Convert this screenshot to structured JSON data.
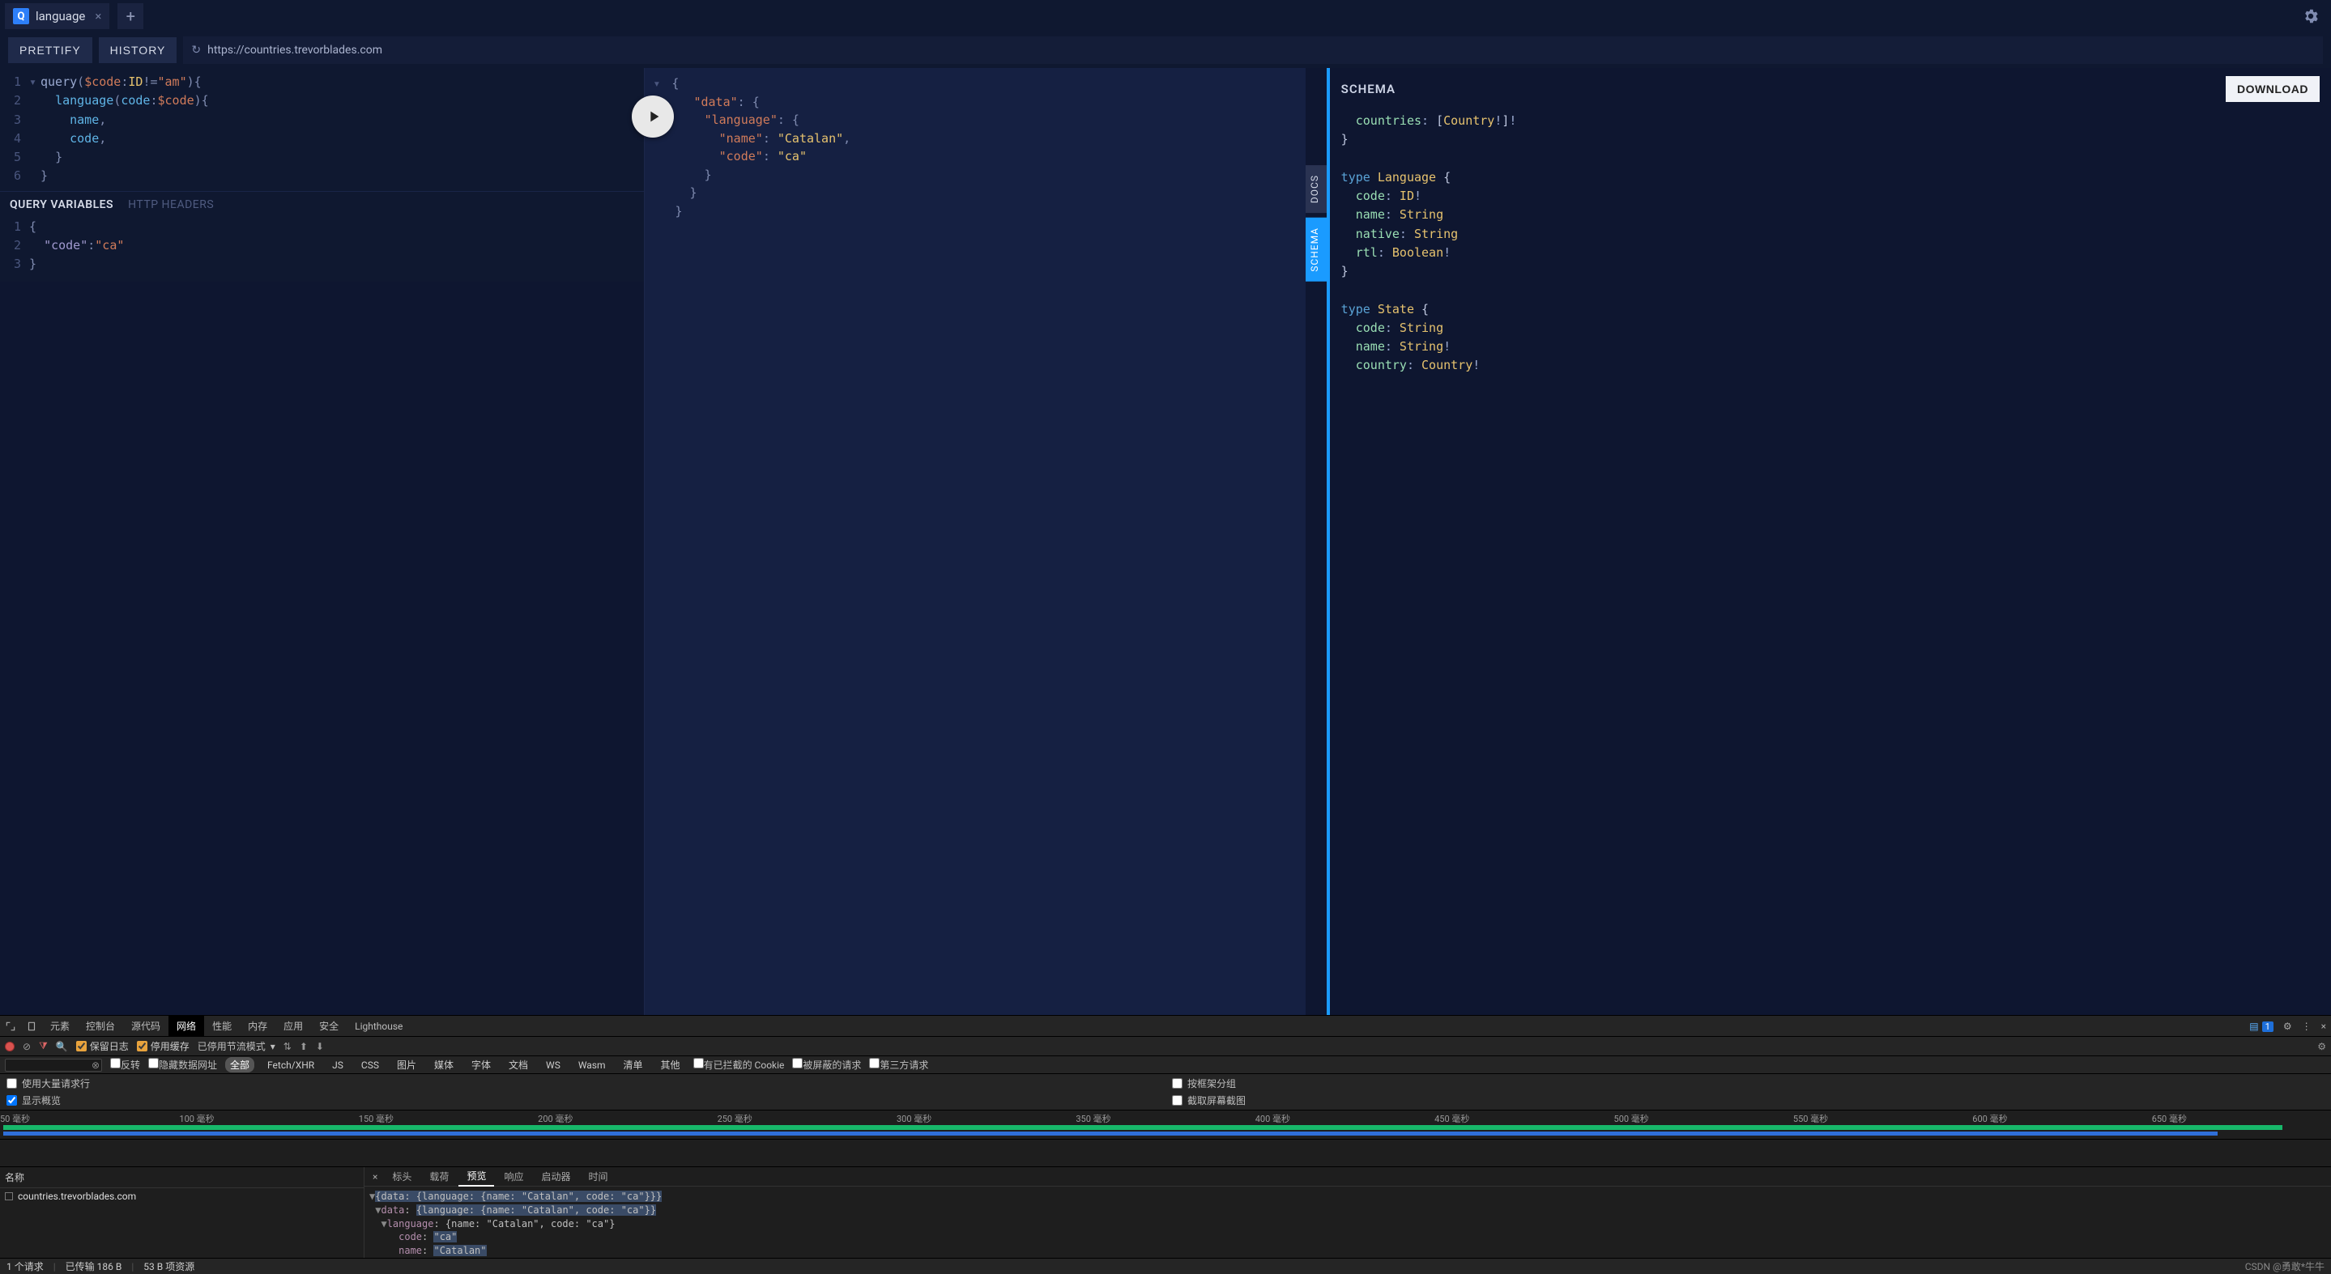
{
  "tabs": {
    "active_label": "language",
    "badge": "Q"
  },
  "toolbar": {
    "prettify": "PRETTIFY",
    "history": "HISTORY",
    "url": "https://countries.trevorblades.com"
  },
  "query": {
    "lines": [
      "query($code:ID!=\"am\"){",
      "  language(code:$code){",
      "    name,",
      "    code,",
      "  }",
      "}"
    ]
  },
  "vars_header": {
    "active": "QUERY VARIABLES",
    "inactive": "HTTP HEADERS"
  },
  "variables": {
    "lines": [
      "{",
      "  \"code\":\"ca\"",
      "}"
    ]
  },
  "result": {
    "text": "{\n  \"data\": {\n    \"language\": {\n      \"name\": \"Catalan\",\n      \"code\": \"ca\"\n    }\n  }\n}"
  },
  "sidetabs": {
    "docs": "DOCS",
    "schema": "SCHEMA"
  },
  "schema_panel": {
    "title": "SCHEMA",
    "download": "DOWNLOAD"
  },
  "schema_code": "  countries: [Country!]!\n}\n\ntype Language {\n  code: ID!\n  name: String\n  native: String\n  rtl: Boolean!\n}\n\ntype State {\n  code: String\n  name: String!\n  country: Country!",
  "devtools": {
    "tabs": [
      "元素",
      "控制台",
      "源代码",
      "网络",
      "性能",
      "内存",
      "应用",
      "安全",
      "Lighthouse"
    ],
    "active_tab": "网络",
    "msg_count": "1",
    "toolbar": {
      "preserve_log": "保留日志",
      "disable_cache": "停用缓存",
      "throttle": "已停用节流模式"
    },
    "filter": {
      "invert": "反转",
      "hide_data_urls": "隐藏数据网址",
      "types": [
        "全部",
        "Fetch/XHR",
        "JS",
        "CSS",
        "图片",
        "媒体",
        "字体",
        "文档",
        "WS",
        "Wasm",
        "清单",
        "其他"
      ],
      "blocked_cookies": "有已拦截的 Cookie",
      "blocked_requests": "被屏蔽的请求",
      "third_party": "第三方请求"
    },
    "options": {
      "large_rows": "使用大量请求行",
      "group_by_frame": "按框架分组",
      "show_overview": "显示概览",
      "screenshot": "截取屏幕截图"
    },
    "ticks": [
      "50 毫秒",
      "100 毫秒",
      "150 毫秒",
      "200 毫秒",
      "250 毫秒",
      "300 毫秒",
      "350 毫秒",
      "400 毫秒",
      "450 毫秒",
      "500 毫秒",
      "550 毫秒",
      "600 毫秒",
      "650 毫秒"
    ],
    "name_header": "名称",
    "request_name": "countries.trevorblades.com",
    "detail_tabs": [
      "标头",
      "载荷",
      "预览",
      "响应",
      "启动器",
      "时间"
    ],
    "detail_active": "预览",
    "preview_lines": [
      "▼{data: {language: {name: \"Catalan\", code: \"ca\"}}}",
      " ▼data: {language: {name: \"Catalan\", code: \"ca\"}}",
      "  ▼language: {name: \"Catalan\", code: \"ca\"}",
      "     code: \"ca\"",
      "     name: \"Catalan\""
    ],
    "status": {
      "requests": "1 个请求",
      "transferred": "已传输 186 B",
      "resources": "53 B 项资源",
      "watermark": "CSDN @勇敢*牛牛"
    }
  }
}
